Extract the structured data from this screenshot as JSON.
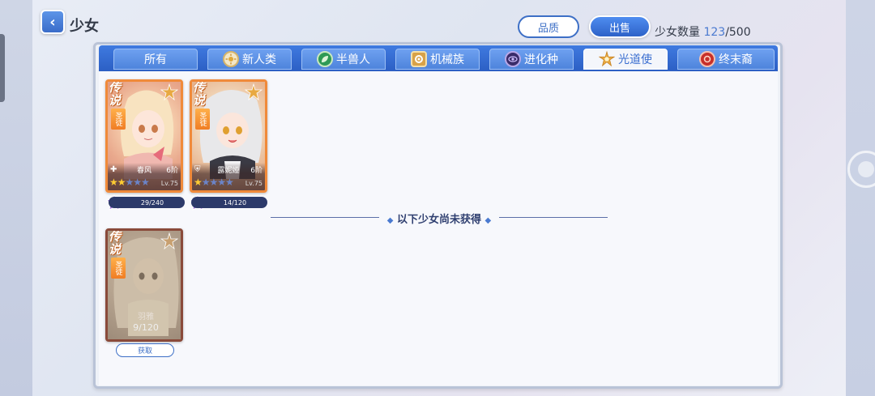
{
  "header": {
    "title": "少女",
    "quality_label": "品质",
    "sell_label": "出售",
    "count_label": "少女数量",
    "count_current": "123",
    "count_max": "/500"
  },
  "tabs": [
    {
      "label": "所有",
      "icon": "none"
    },
    {
      "label": "新人类",
      "icon": "sun-emblem-icon"
    },
    {
      "label": "半兽人",
      "icon": "leaf-emblem-icon"
    },
    {
      "label": "机械族",
      "icon": "gear-emblem-icon"
    },
    {
      "label": "进化种",
      "icon": "eye-emblem-icon"
    },
    {
      "label": "光道使",
      "icon": "star-emblem-icon"
    },
    {
      "label": "终末裔",
      "icon": "fire-emblem-icon"
    }
  ],
  "active_tab": "光道使",
  "rarity": {
    "top": "传说",
    "sub": "圣徒"
  },
  "owned": [
    {
      "name": "春风",
      "stage": "6阶",
      "stars_on": 2,
      "stars_total": 5,
      "level": "Lv.75",
      "fragments": "29/240",
      "class_icon": "plus-icon"
    },
    {
      "name": "露妮娅",
      "stage": "6阶",
      "stars_on": 1,
      "stars_total": 5,
      "level": "Lv.75",
      "fragments": "14/120",
      "class_icon": "shield-icon"
    }
  ],
  "divider_text": "以下少女尚未获得",
  "locked": [
    {
      "name": "羽雅",
      "fragments": "9/120",
      "button": "获取"
    }
  ],
  "colors": {
    "accent": "#3d6fc6",
    "tab_bar": "#2c5fc4",
    "card_border": "#f08a3a"
  }
}
